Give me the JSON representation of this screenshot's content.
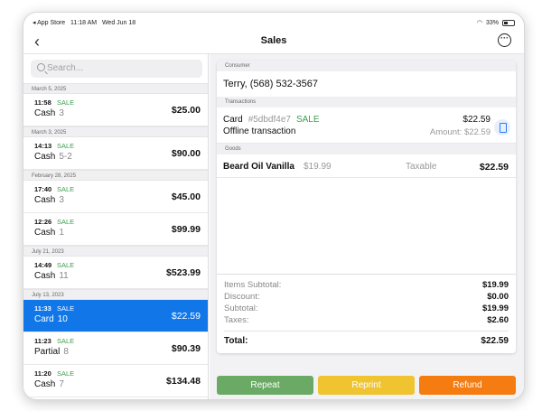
{
  "status_bar": {
    "app_store": "◂ App Store",
    "time": "11:18 AM",
    "date": "Wed Jun 18",
    "battery": "33%"
  },
  "nav": {
    "back_icon": "‹",
    "title": "Sales",
    "more_icon": "···"
  },
  "search": {
    "placeholder": "Search..."
  },
  "transactions": [
    {
      "date": "March 5, 2025",
      "items": [
        {
          "time": "11:58",
          "type": "SALE",
          "method": "Cash",
          "count": "3",
          "amount": "$25.00"
        }
      ]
    },
    {
      "date": "March 3, 2025",
      "items": [
        {
          "time": "14:13",
          "type": "SALE",
          "method": "Cash",
          "count": "5-2",
          "amount": "$90.00"
        }
      ]
    },
    {
      "date": "February 28, 2025",
      "items": [
        {
          "time": "17:40",
          "type": "SALE",
          "method": "Cash",
          "count": "3",
          "amount": "$45.00"
        },
        {
          "time": "12:26",
          "type": "SALE",
          "method": "Cash",
          "count": "1",
          "amount": "$99.99"
        }
      ]
    },
    {
      "date": "July 21, 2023",
      "items": [
        {
          "time": "14:49",
          "type": "SALE",
          "method": "Cash",
          "count": "11",
          "amount": "$523.99"
        }
      ]
    },
    {
      "date": "July 13, 2023",
      "items": [
        {
          "time": "11:33",
          "type": "SALE",
          "method": "Card",
          "count": "10",
          "amount": "$22.59"
        },
        {
          "time": "11:23",
          "type": "SALE",
          "method": "Partial",
          "count": "8",
          "amount": "$90.39"
        },
        {
          "time": "11:20",
          "type": "SALE",
          "method": "Cash",
          "count": "7",
          "amount": "$134.48"
        }
      ]
    }
  ],
  "detail": {
    "consumer_header": "Consumer",
    "consumer": "Terry, (568) 532-3567",
    "transactions_header": "Transactions",
    "txn_method": "Card",
    "txn_id": "#5dbdf4e7",
    "txn_type": "SALE",
    "txn_note": "Offline transaction",
    "txn_amount": "$22.59",
    "txn_amount_line": "Amount: $22.59",
    "goods_header": "Goods",
    "goods": [
      {
        "name": "Beard Oil Vanilla",
        "price": "$19.99",
        "tax": "Taxable",
        "total": "$22.59"
      }
    ],
    "totals": [
      {
        "label": "Items Subtotal:",
        "value": "$19.99"
      },
      {
        "label": "Discount:",
        "value": "$0.00"
      },
      {
        "label": "Subtotal:",
        "value": "$19.99"
      },
      {
        "label": "Taxes:",
        "value": "$2.60"
      }
    ],
    "total_label": "Total:",
    "total_value": "$22.59"
  },
  "actions": {
    "repeat": "Repeat",
    "reprint": "Reprint",
    "refund": "Refund"
  },
  "colors": {
    "accent": "#1177e8",
    "sale_green": "#3aa14a",
    "repeat": "#6aaa64",
    "reprint": "#f0c330",
    "refund": "#f57c11"
  }
}
